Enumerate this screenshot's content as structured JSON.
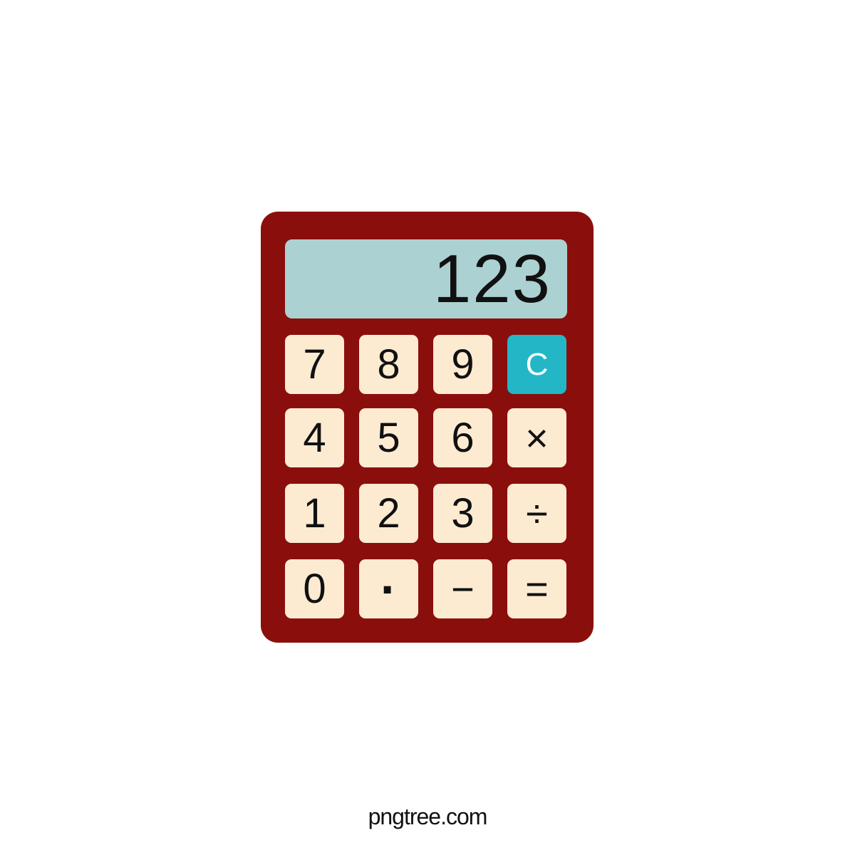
{
  "display": {
    "value": "123"
  },
  "keys": [
    {
      "label": "7",
      "name": "key-7"
    },
    {
      "label": "8",
      "name": "key-8"
    },
    {
      "label": "9",
      "name": "key-9"
    },
    {
      "label": "C",
      "name": "clear-button"
    },
    {
      "label": "4",
      "name": "key-4"
    },
    {
      "label": "5",
      "name": "key-5"
    },
    {
      "label": "6",
      "name": "key-6"
    },
    {
      "label": "×",
      "name": "multiply-button"
    },
    {
      "label": "1",
      "name": "key-1"
    },
    {
      "label": "2",
      "name": "key-2"
    },
    {
      "label": "3",
      "name": "key-3"
    },
    {
      "label": "÷",
      "name": "divide-button"
    },
    {
      "label": "0",
      "name": "key-0"
    },
    {
      "label": "·",
      "name": "decimal-point-button"
    },
    {
      "label": "−",
      "name": "minus-button"
    },
    {
      "label": "=",
      "name": "equals-button"
    }
  ],
  "colors": {
    "body": "#8a0f0c",
    "display": "#acd1d2",
    "key": "#fdebd1",
    "clear_key": "#23b6c6"
  },
  "watermark": "pngtree.com"
}
